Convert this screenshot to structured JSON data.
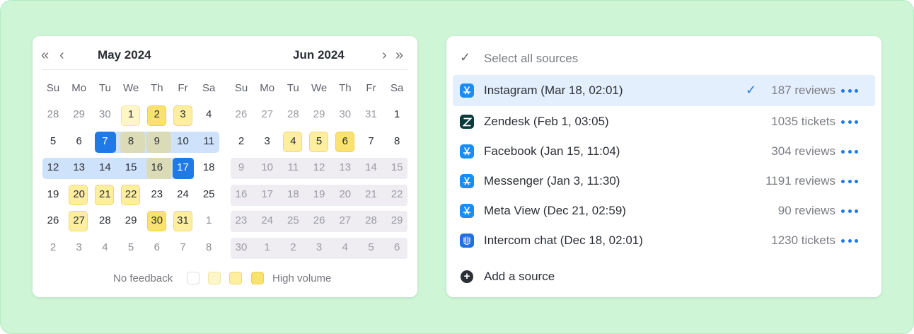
{
  "calendar": {
    "left_month": {
      "title": "May 2024",
      "weekdays": [
        "Su",
        "Mo",
        "Tu",
        "We",
        "Th",
        "Fr",
        "Sa"
      ],
      "weeks": [
        [
          "28",
          "29",
          "30",
          "1",
          "2",
          "3",
          "4"
        ],
        [
          "5",
          "6",
          "7",
          "8",
          "9",
          "10",
          "11"
        ],
        [
          "12",
          "13",
          "14",
          "15",
          "16",
          "17",
          "18"
        ],
        [
          "19",
          "20",
          "21",
          "22",
          "23",
          "24",
          "25"
        ],
        [
          "26",
          "27",
          "28",
          "29",
          "30",
          "31",
          "1"
        ],
        [
          "2",
          "3",
          "4",
          "5",
          "6",
          "7",
          "8"
        ]
      ]
    },
    "right_month": {
      "title": "Jun 2024",
      "weekdays": [
        "Su",
        "Mo",
        "Tu",
        "We",
        "Th",
        "Fr",
        "Sa"
      ],
      "weeks": [
        [
          "26",
          "27",
          "28",
          "29",
          "30",
          "31",
          "1"
        ],
        [
          "2",
          "3",
          "4",
          "5",
          "6",
          "7",
          "8"
        ],
        [
          "9",
          "10",
          "11",
          "12",
          "13",
          "14",
          "15"
        ],
        [
          "16",
          "17",
          "18",
          "19",
          "20",
          "21",
          "22"
        ],
        [
          "23",
          "24",
          "25",
          "26",
          "27",
          "28",
          "29"
        ],
        [
          "30",
          "1",
          "2",
          "3",
          "4",
          "5",
          "6"
        ]
      ]
    },
    "selected_range": {
      "start": "May 7, 2024",
      "end": "May 17, 2024"
    },
    "legend": {
      "low_label": "No feedback",
      "high_label": "High volume"
    },
    "colors": {
      "heat_1": "#fdf6c9",
      "heat_2": "#fdef9f",
      "heat_3": "#fae26f",
      "selected": "#1f7ae8",
      "range": "#cfe2fb",
      "disabled": "#efedf2"
    }
  },
  "sources": {
    "select_all_label": "Select all sources",
    "items": [
      {
        "name": "Instagram (Mar 18, 02:01)",
        "count": "187 reviews",
        "icon": "app-store-icon",
        "selected": true
      },
      {
        "name": "Zendesk (Feb 1, 03:05)",
        "count": "1035 tickets",
        "icon": "zendesk-icon"
      },
      {
        "name": "Facebook (Jan 15, 11:04)",
        "count": "304 reviews",
        "icon": "app-store-icon"
      },
      {
        "name": "Messenger (Jan 3, 11:30)",
        "count": "1191 reviews",
        "icon": "app-store-icon"
      },
      {
        "name": "Meta View (Dec 21, 02:59)",
        "count": "90 reviews",
        "icon": "app-store-icon"
      },
      {
        "name": "Intercom chat (Dec 18, 02:01)",
        "count": "1230 tickets",
        "icon": "intercom-icon"
      }
    ],
    "add_label": "Add a source"
  }
}
